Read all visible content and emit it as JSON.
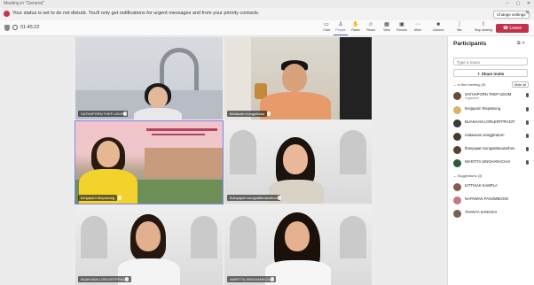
{
  "window": {
    "title": "Meeting in \"General\""
  },
  "banner": {
    "text": "Your status is set to do not disturb. You'll only get notifications for urgent messages and from your priority contacts.",
    "button": "Change settings"
  },
  "toolbar": {
    "timer": "01:45:22",
    "buttons": [
      {
        "label": "Chat",
        "icon": "chat-icon",
        "glyph": "▭"
      },
      {
        "label": "People",
        "icon": "people-icon",
        "glyph": "♙"
      },
      {
        "label": "Raise",
        "icon": "raise-hand-icon",
        "glyph": "✋"
      },
      {
        "label": "React",
        "icon": "react-icon",
        "glyph": "☺"
      },
      {
        "label": "View",
        "icon": "view-icon",
        "glyph": "▦"
      },
      {
        "label": "Rooms",
        "icon": "rooms-icon",
        "glyph": "▣"
      },
      {
        "label": "More",
        "icon": "more-icon",
        "glyph": "⋯"
      },
      {
        "label": "Camera",
        "icon": "camera-icon",
        "glyph": "■"
      },
      {
        "label": "Mic",
        "icon": "mic-icon",
        "glyph": "⏐"
      },
      {
        "label": "Stop sharing",
        "icon": "share-icon",
        "glyph": "⇪"
      }
    ],
    "leave": "Leave"
  },
  "tiles": [
    {
      "name": "SATHAPORN THEP-UDOM"
    },
    {
      "name": "thidawan mongpittaka"
    },
    {
      "name": "benjaporn thepswong"
    },
    {
      "name": "thanyapat mungsattanasuthon"
    },
    {
      "name": "BUAKHAM LORLERTPRADIT"
    },
    {
      "name": "WARITTA SINGHARACHAI"
    }
  ],
  "panel": {
    "title": "Participants",
    "search_placeholder": "Type a name",
    "share": "Share invite",
    "in_meeting": "In this meeting (9)",
    "mute_all": "Mute all",
    "participants": [
      {
        "name": "SATHAPORN THEP-UDOM",
        "role": "Organizer",
        "color": "#6b4a3a"
      },
      {
        "name": "benjaporn thepswong",
        "role": "",
        "color": "#d8b36a"
      },
      {
        "name": "BUAKHAM LORLERTPRADIT",
        "role": "",
        "color": "#3a3a3a"
      },
      {
        "name": "nattawoon wongjitratorn",
        "role": "",
        "color": "#4a3a2a"
      },
      {
        "name": "thanyapat mungsattanasuthon",
        "role": "",
        "color": "#5a4030"
      },
      {
        "name": "WARITTA SINGHARACHAI",
        "role": "",
        "color": "#2e5a3a"
      }
    ],
    "suggestions": "Suggestions (3)",
    "suggested": [
      {
        "name": "KITTISAK KAMPLA",
        "color": "#8a5a4a"
      },
      {
        "name": "NAPAWAN PASOMBOON",
        "color": "#c07a80"
      },
      {
        "name": "THANYA SANGSAI",
        "color": "#7a6050"
      }
    ]
  }
}
